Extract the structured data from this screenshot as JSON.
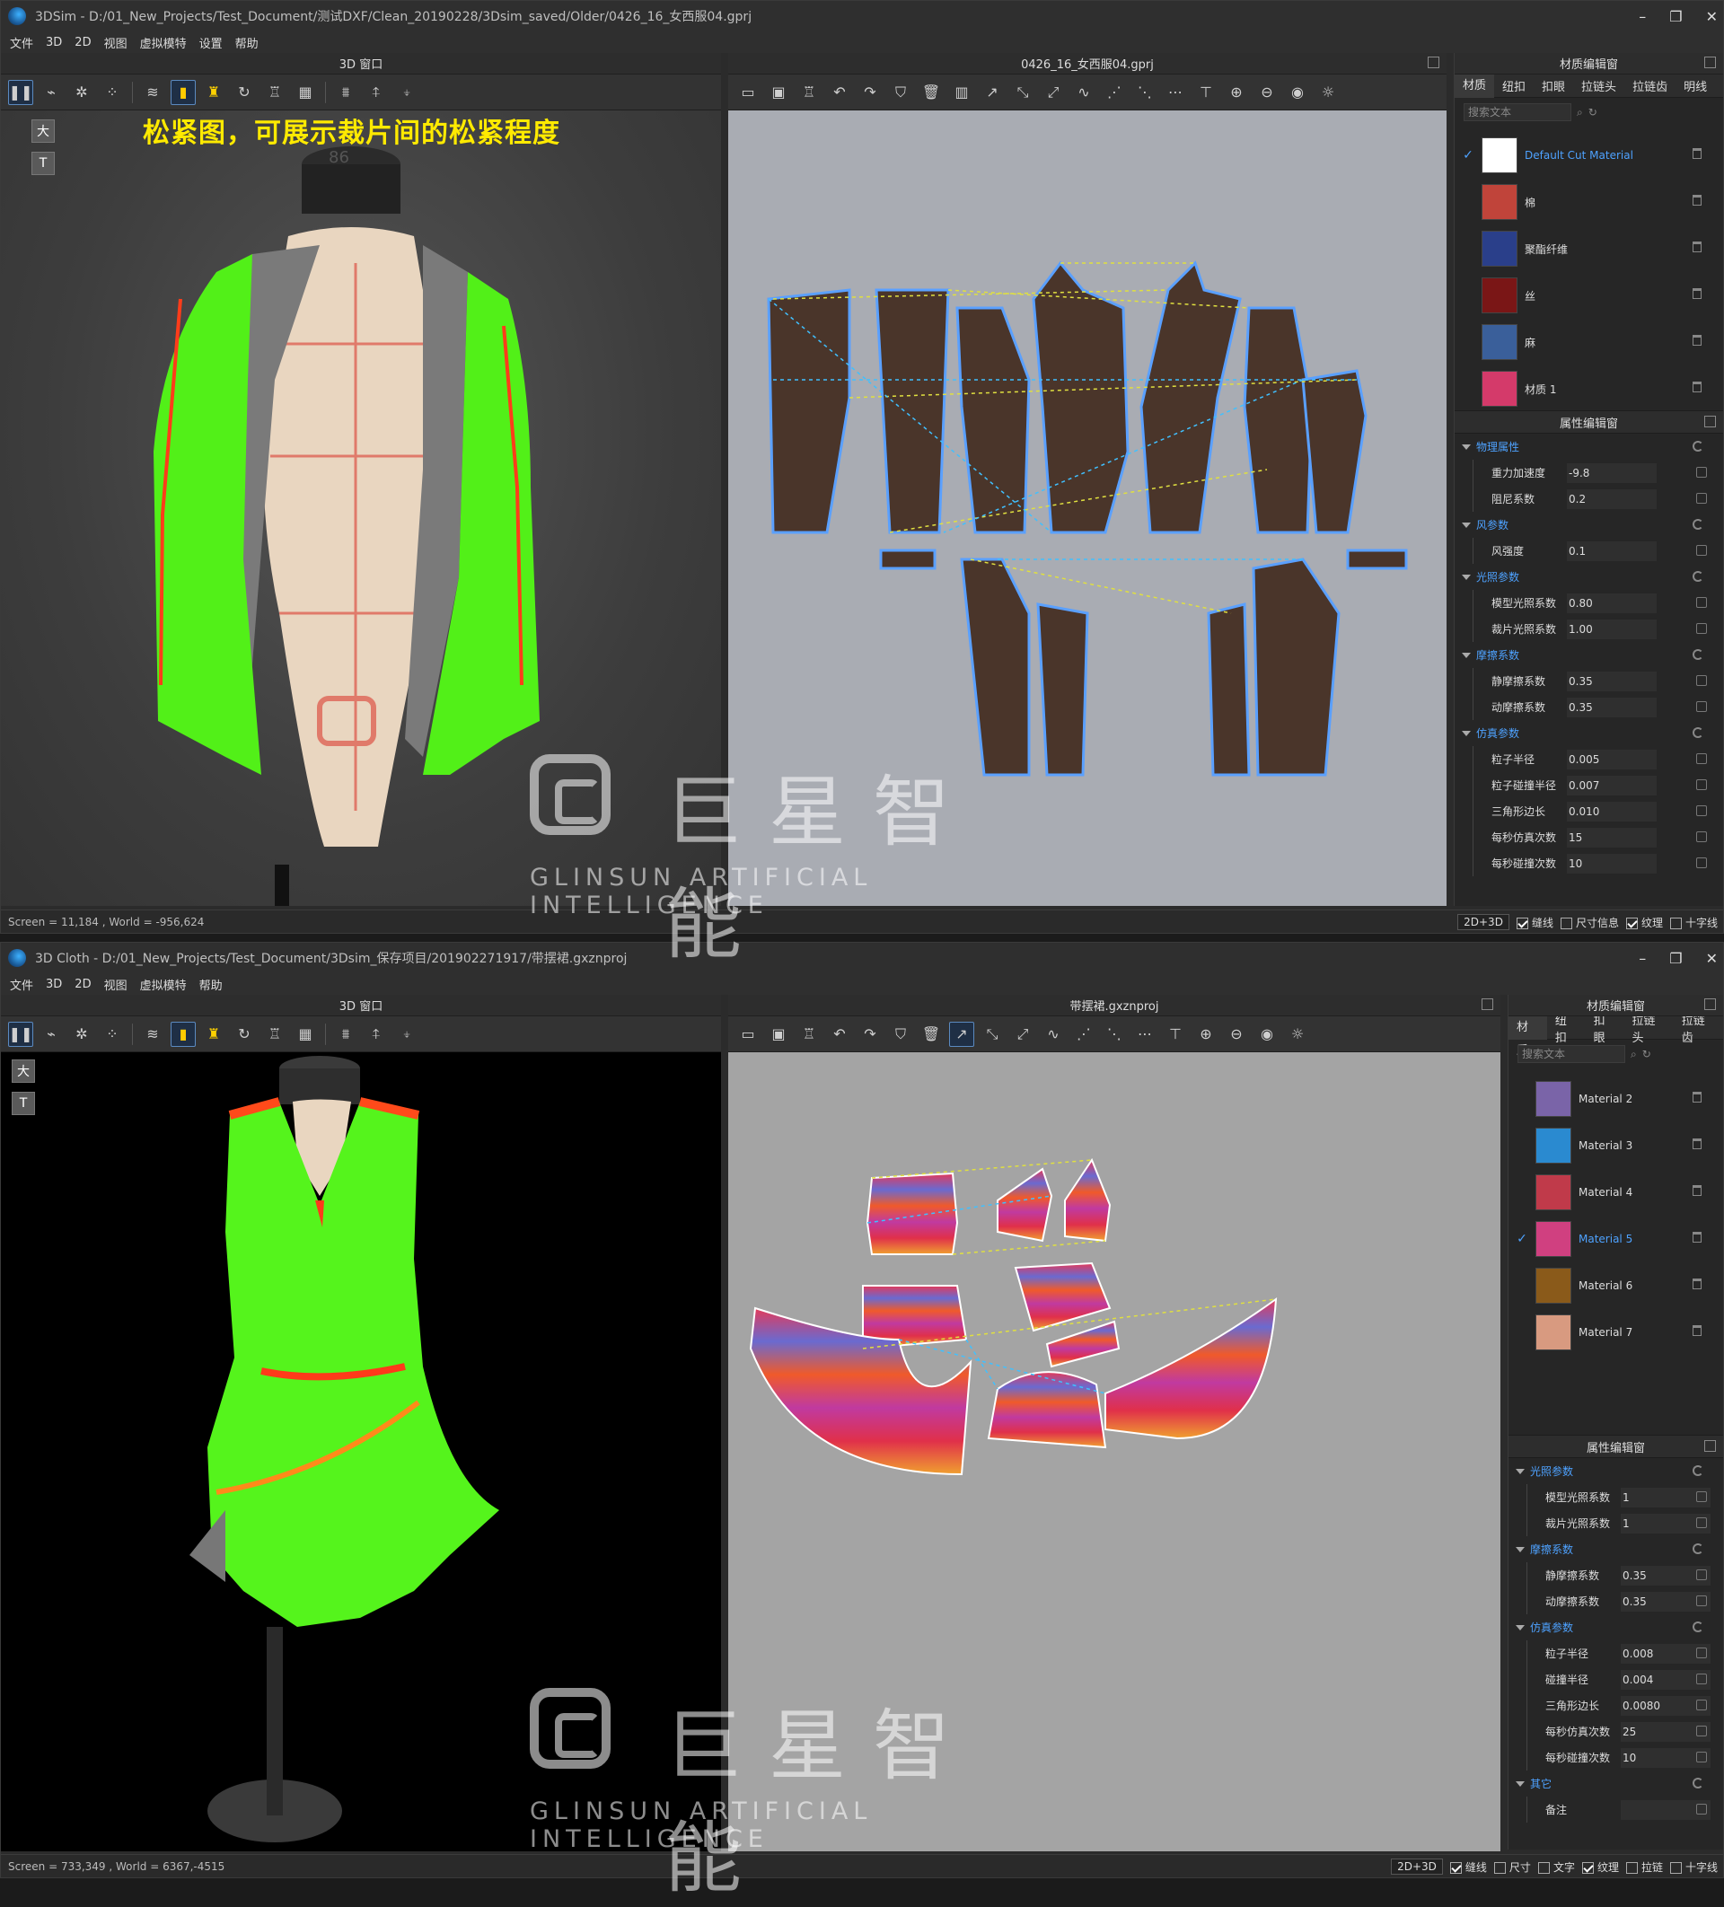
{
  "window1": {
    "title": "3DSim - D:/01_New_Projects/Test_Document/测试DXF/Clean_20190228/3Dsim_saved/Older/0426_16_女西服04.gprj",
    "menu": [
      "文件",
      "3D",
      "2D",
      "视图",
      "虚拟模特",
      "设置",
      "帮助"
    ],
    "panel3d_title": "3D 窗口",
    "panel2d_title": "0426_16_女西服04.gprj",
    "overlay_caption": "松紧图，可展示裁片间的松紧程度",
    "side_icons": [
      "大",
      "T"
    ],
    "material_editor": {
      "title": "材质编辑窗",
      "tabs": [
        "材质",
        "纽扣",
        "扣眼",
        "拉链头",
        "拉链齿",
        "明线"
      ],
      "search_placeholder": "搜索文本",
      "materials": [
        {
          "name": "Default Cut Material",
          "selected": true,
          "color": "#ffffff"
        },
        {
          "name": "棉",
          "selected": false,
          "color": "#c0443a"
        },
        {
          "name": "聚酯纤维",
          "selected": false,
          "color": "#2a3f8a"
        },
        {
          "name": "丝",
          "selected": false,
          "color": "#7a1616"
        },
        {
          "name": "麻",
          "selected": false,
          "color": "#3a5f9a"
        },
        {
          "name": "材质 1",
          "selected": false,
          "color": "#d43a6a"
        }
      ]
    },
    "property_editor": {
      "title": "属性编辑窗",
      "sections": [
        {
          "name": "物理属性",
          "rows": [
            {
              "label": "重力加速度",
              "value": "-9.8"
            },
            {
              "label": "阻尼系数",
              "value": "0.2"
            }
          ]
        },
        {
          "name": "风参数",
          "rows": [
            {
              "label": "风强度",
              "value": "0.1"
            }
          ]
        },
        {
          "name": "光照参数",
          "rows": [
            {
              "label": "模型光照系数",
              "value": "0.80"
            },
            {
              "label": "裁片光照系数",
              "value": "1.00"
            }
          ]
        },
        {
          "name": "摩擦系数",
          "rows": [
            {
              "label": "静摩擦系数",
              "value": "0.35"
            },
            {
              "label": "动摩擦系数",
              "value": "0.35"
            }
          ]
        },
        {
          "name": "仿真参数",
          "rows": [
            {
              "label": "粒子半径",
              "value": "0.005"
            },
            {
              "label": "粒子碰撞半径",
              "value": "0.007"
            },
            {
              "label": "三角形边长",
              "value": "0.010"
            },
            {
              "label": "每秒仿真次数",
              "value": "15"
            },
            {
              "label": "每秒碰撞次数",
              "value": "10"
            }
          ]
        }
      ]
    },
    "status": {
      "coords": "Screen = 11,184 , World = -956,624",
      "mode": "2D+3D",
      "toggles": [
        {
          "label": "缝线",
          "checked": true
        },
        {
          "label": "尺寸信息",
          "checked": false
        },
        {
          "label": "纹理",
          "checked": true
        },
        {
          "label": "十字线",
          "checked": false
        }
      ]
    }
  },
  "window2": {
    "title": "3D Cloth - D:/01_New_Projects/Test_Document/3Dsim_保存项目/201902271917/带摆裙.gxznproj",
    "menu": [
      "文件",
      "3D",
      "2D",
      "视图",
      "虚拟模特",
      "帮助"
    ],
    "panel3d_title": "3D 窗口",
    "panel2d_title": "带摆裙.gxznproj",
    "side_icons": [
      "大",
      "T"
    ],
    "material_editor": {
      "title": "材质编辑窗",
      "tabs": [
        "材质",
        "纽扣",
        "扣眼",
        "拉链头",
        "拉链齿"
      ],
      "search_placeholder": "搜索文本",
      "materials": [
        {
          "name": "Material 2",
          "selected": false,
          "color": "#7a64a8"
        },
        {
          "name": "Material 3",
          "selected": false,
          "color": "#2a8ad0"
        },
        {
          "name": "Material 4",
          "selected": false,
          "color": "#c03a4a"
        },
        {
          "name": "Material 5",
          "selected": true,
          "color": "#d04080"
        },
        {
          "name": "Material 6",
          "selected": false,
          "color": "#8a5a1a"
        },
        {
          "name": "Material 7",
          "selected": false,
          "color": "#d89a80"
        }
      ]
    },
    "property_editor": {
      "title": "属性编辑窗",
      "sections": [
        {
          "name": "光照参数",
          "rows": [
            {
              "label": "模型光照系数",
              "value": "1"
            },
            {
              "label": "裁片光照系数",
              "value": "1"
            }
          ]
        },
        {
          "name": "摩擦系数",
          "rows": [
            {
              "label": "静摩擦系数",
              "value": "0.35"
            },
            {
              "label": "动摩擦系数",
              "value": "0.35"
            }
          ]
        },
        {
          "name": "仿真参数",
          "rows": [
            {
              "label": "粒子半径",
              "value": "0.008"
            },
            {
              "label": "碰撞半径",
              "value": "0.004"
            },
            {
              "label": "三角形边长",
              "value": "0.0080"
            },
            {
              "label": "每秒仿真次数",
              "value": "25"
            },
            {
              "label": "每秒碰撞次数",
              "value": "10"
            }
          ]
        },
        {
          "name": "其它",
          "rows": [
            {
              "label": "备注",
              "value": ""
            }
          ]
        }
      ]
    },
    "status": {
      "coords": "Screen = 733,349 , World = 6367,-4515",
      "mode": "2D+3D",
      "toggles": [
        {
          "label": "缝线",
          "checked": true
        },
        {
          "label": "尺寸",
          "checked": false
        },
        {
          "label": "文字",
          "checked": false
        },
        {
          "label": "纹理",
          "checked": true
        },
        {
          "label": "拉链",
          "checked": false
        },
        {
          "label": "十字线",
          "checked": false
        }
      ]
    }
  },
  "watermark": {
    "cn": "巨星智能",
    "en": "GLINSUN ARTIFICIAL INTELLIGENCE"
  },
  "icons": {
    "toolbar3d": [
      "pause-icon",
      "fold-icon",
      "scatter-icon",
      "points-icon",
      "wind-icon",
      "stress-map-icon",
      "shirt-icon",
      "refresh-icon",
      "tshirt-icon",
      "grid-icon",
      "hanger-icon",
      "pin-icon",
      "pin2-icon"
    ],
    "toolbar2d": [
      "open-icon",
      "save-icon",
      "delete-icon",
      "undo-icon",
      "redo-icon",
      "tshirt-icon",
      "trash-icon",
      "book-icon",
      "select-icon",
      "edit-point-icon",
      "add-point-icon",
      "curve-icon",
      "seam-icon",
      "seam2-icon",
      "seam3-icon",
      "align-icon",
      "target-icon",
      "minus-icon",
      "eye-icon",
      "bulb-icon"
    ]
  }
}
